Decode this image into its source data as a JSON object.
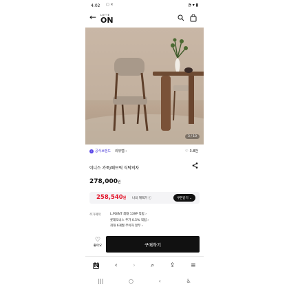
{
  "status": {
    "time": "4:02",
    "glyph": "▢ ✕",
    "icons": "◔ ▾ ▮"
  },
  "header": {
    "logo_small": "LOTTE",
    "logo_big": "ON"
  },
  "photo": {
    "counter": "3 / 10"
  },
  "badge": {
    "label": "공식브랜드",
    "review": "리뷰탭 ›"
  },
  "like": {
    "count": "3.8천"
  },
  "product": {
    "title": "이니스 가죽/패브릭 식탁의자",
    "price": "278,000",
    "price_unit": "원"
  },
  "promo": {
    "sale_price": "258,540",
    "sale_unit": "원",
    "mine": "나의 혜택가 ⓘ",
    "coupon": "쿠폰받기 ⌄"
  },
  "benefits": {
    "label": "추가혜택",
    "line1": "L.POINT 최대 139P 적립 ›",
    "line2": "롯데오너스 추가 0.5% 적립 ›",
    "line3": "최대 6개월 무이자 할부 ›"
  },
  "actions": {
    "wish": "좋아요",
    "buy": "구매하기"
  },
  "browser": {
    "n": "N",
    "back": "‹",
    "fwd": "›",
    "search": "⌕",
    "share": "⇪",
    "menu": "≡"
  },
  "sysnav": {
    "recent": "|||",
    "home": "○",
    "back": "‹",
    "acc": "♿"
  }
}
